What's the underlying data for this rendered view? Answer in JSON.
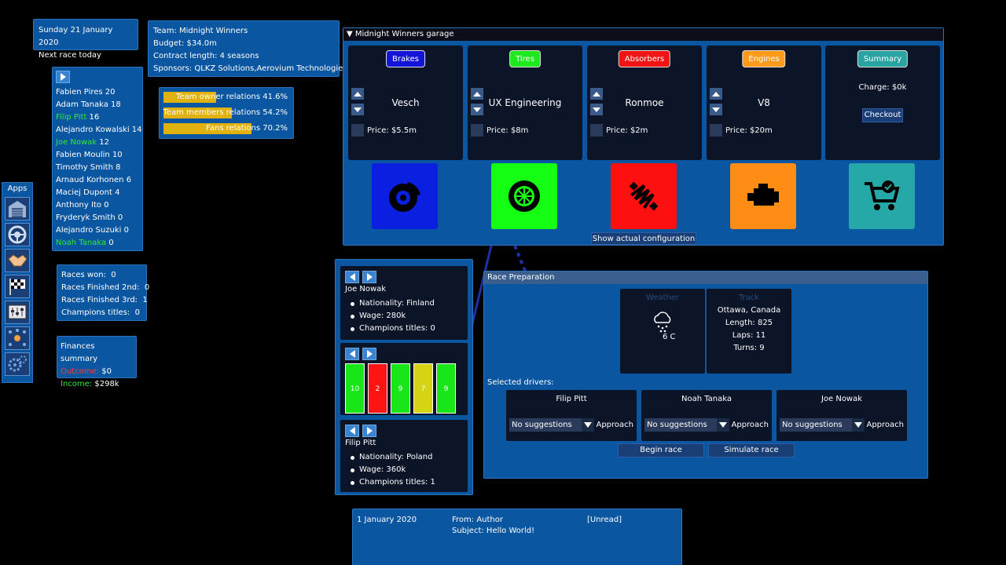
{
  "date_panel": {
    "date": "Sunday 21 January 2020",
    "next_race": "Next race today"
  },
  "team_panel": {
    "team": "Team: Midnight Winners",
    "budget": "Budget: $34.0m",
    "contract": "Contract length: 4 seasons",
    "sponsors": "Sponsors: QLKZ Solutions,Aerovium Technologies"
  },
  "drivers_list": [
    {
      "name": "Fabien Pires",
      "points": "20",
      "highlight": false
    },
    {
      "name": "Adam Tanaka",
      "points": "18",
      "highlight": false
    },
    {
      "name": "Filip Pitt",
      "points": "16",
      "highlight": true
    },
    {
      "name": "Alejandro Kowalski",
      "points": "14",
      "highlight": false
    },
    {
      "name": "Joe Nowak",
      "points": "12",
      "highlight": true
    },
    {
      "name": "Fabien Moulin",
      "points": "10",
      "highlight": false
    },
    {
      "name": "Timothy Smith",
      "points": "8",
      "highlight": false
    },
    {
      "name": "Arnaud Korhonen",
      "points": "6",
      "highlight": false
    },
    {
      "name": "Maciej Dupont",
      "points": "4",
      "highlight": false
    },
    {
      "name": "Anthony Ito",
      "points": "0",
      "highlight": false
    },
    {
      "name": "Fryderyk Smith",
      "points": "0",
      "highlight": false
    },
    {
      "name": "Alejandro Suzuki",
      "points": "0",
      "highlight": false
    },
    {
      "name": "Noah Tanaka",
      "points": "0",
      "highlight": true
    }
  ],
  "relations": [
    {
      "label": "Team owner relations 41.6%",
      "value": 0.416
    },
    {
      "label": "Team members relations 54.2%",
      "value": 0.542
    },
    {
      "label": "Fans relations 70.2%",
      "value": 0.702
    }
  ],
  "apps": {
    "title": "Apps",
    "icons": [
      "garage-icon",
      "steering-wheel-icon",
      "handshake-icon",
      "checkered-flag-icon",
      "control-panel-icon",
      "staff-network-icon",
      "gears-icon"
    ]
  },
  "stats": {
    "won": "Races won:  0",
    "second": "Races Finished 2nd:  0",
    "third": "Races Finished 3rd:  1",
    "titles": "Champions titles:  0"
  },
  "finances": {
    "title": "Finances summary",
    "outcome_label": "Outcome:",
    "outcome_value": "$0",
    "income_label": "Income:",
    "income_value": "$298k"
  },
  "garage": {
    "title": "Midnight Winners garage",
    "parts": [
      {
        "tag": "Brakes",
        "tag_color": "#1414d8",
        "name": "Vesch",
        "price": "Price: $5.5m",
        "tile_color": "#0a1fe0",
        "icon": "brake-disc-icon"
      },
      {
        "tag": "Tires",
        "tag_color": "#1ee81e",
        "name": "UX Engineering",
        "price": "Price: $8m",
        "tile_color": "#14ff14",
        "icon": "tire-icon"
      },
      {
        "tag": "Absorbers",
        "tag_color": "#f01414",
        "name": "Ronmoe",
        "price": "Price: $2m",
        "tile_color": "#ff1010",
        "icon": "shock-absorber-icon"
      },
      {
        "tag": "Engines",
        "tag_color": "#ff9a1a",
        "name": "V8",
        "price": "Price: $20m",
        "tile_color": "#ff8c14",
        "icon": "engine-icon"
      }
    ],
    "summary": {
      "tag": "Summary",
      "charge": "Charge: $0k",
      "checkout": "Checkout"
    },
    "show_config": "Show actual configuration"
  },
  "driver_a": {
    "name": "Joe Nowak",
    "nationality": "Nationality: Finland",
    "wage": "Wage: 280k",
    "titles": "Champions titles: 0"
  },
  "stat_bars": [
    {
      "value": "10",
      "color": "#19e619"
    },
    {
      "value": "2",
      "color": "#ff1414"
    },
    {
      "value": "9",
      "color": "#19e619"
    },
    {
      "value": "7",
      "color": "#d4d414"
    },
    {
      "value": "9",
      "color": "#19e619"
    }
  ],
  "driver_b": {
    "name": "Filip Pitt",
    "nationality": "Nationality: Poland",
    "wage": "Wage: 360k",
    "titles": "Champions titles: 1"
  },
  "race": {
    "title": "Race Preparation",
    "weather_label": "Weather",
    "temperature": "6 C",
    "track_label": "Track",
    "city": "Ottawa, Canada",
    "length": "Length: 825",
    "laps": "Laps: 11",
    "turns": "Turns: 9",
    "selected_label": "Selected drivers:",
    "drivers": [
      {
        "name": "Filip Pitt",
        "suggestion": "No suggestions",
        "approach": "Approach"
      },
      {
        "name": "Noah Tanaka",
        "suggestion": "No suggestions",
        "approach": "Approach"
      },
      {
        "name": "Joe Nowak",
        "suggestion": "No suggestions",
        "approach": "Approach"
      }
    ],
    "begin": "Begin race",
    "simulate": "Simulate race"
  },
  "mail": {
    "date": "1 January 2020",
    "from": "From: Author",
    "status": "[Unread]",
    "subject": "Subject: Hello World!"
  }
}
